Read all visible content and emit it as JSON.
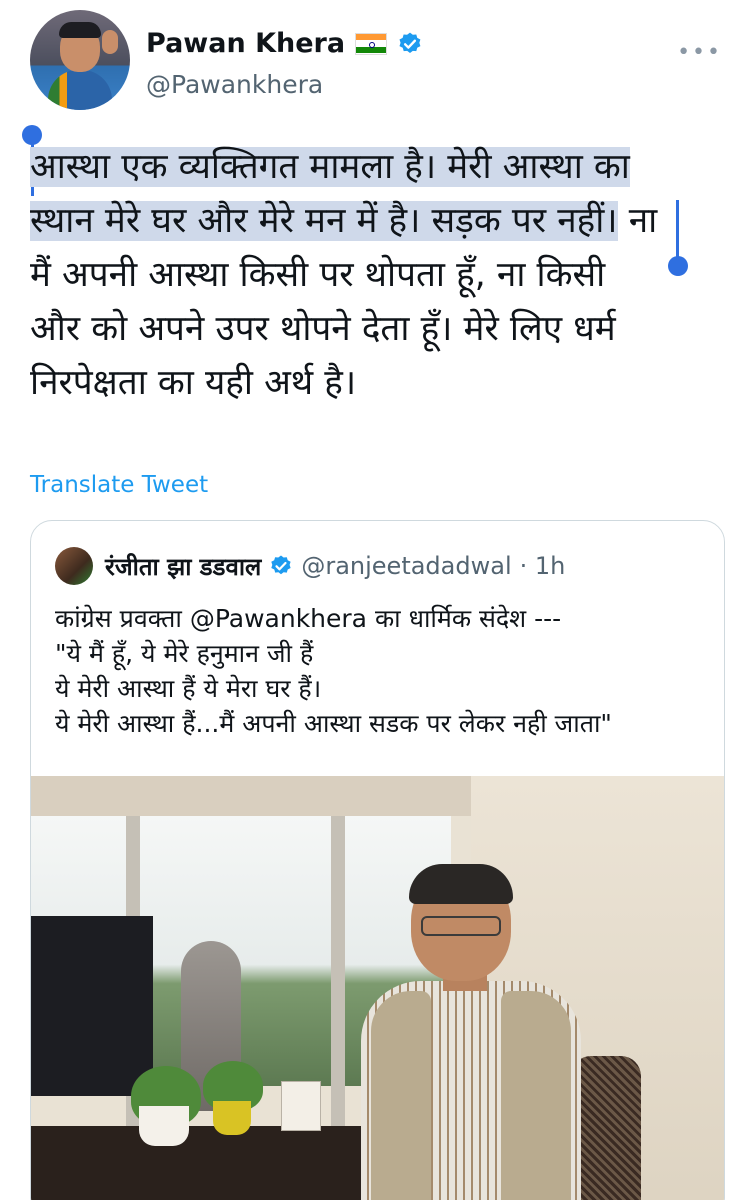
{
  "author": {
    "display_name": "Pawan Khera",
    "flag_icon": "india-flag-icon",
    "verified_icon": "verified-badge-icon",
    "verified_color": "#1d9bf0",
    "handle": "@Pawankhera",
    "more_icon": "more-options-icon"
  },
  "tweet": {
    "lines": [
      {
        "hl": "आस्था एक व्यक्तिगत मामला है। मेरी आस्था का",
        "rest": ""
      },
      {
        "hl": "स्थान मेरे घर और मेरे मन में है। सड़क पर नहीं।",
        "rest": " ना"
      },
      {
        "hl": "",
        "rest": "मैं अपनी आस्था किसी पर थोपता हूँ, ना किसी"
      },
      {
        "hl": "",
        "rest": "और को अपने उपर थोपने देता हूँ। मेरे लिए धर्म"
      },
      {
        "hl": "",
        "rest": "निरपेक्षता का यही अर्थ है।"
      }
    ],
    "translate_label": "Translate Tweet"
  },
  "quote_tweet": {
    "display_name": "रंजीता झा डडवाल",
    "handle": "@ranjeetadadwal",
    "time": "· 1h",
    "lines": [
      "कांग्रेस प्रवक्ता @Pawankhera का धार्मिक संदेश ---",
      "\"ये मैं हूँ, ये मेरे हनुमान जी हैं",
      "ये मेरी आस्था हैं ये मेरा घर हैं।",
      "ये मेरी आस्था हैं...मैं अपनी आस्था सडक पर लेकर नही जाता\""
    ]
  },
  "colors": {
    "selection_highlight": "#cfd9ea",
    "selection_handle": "#2f6fe0",
    "link": "#1d9bf0",
    "secondary_text": "#536471"
  }
}
